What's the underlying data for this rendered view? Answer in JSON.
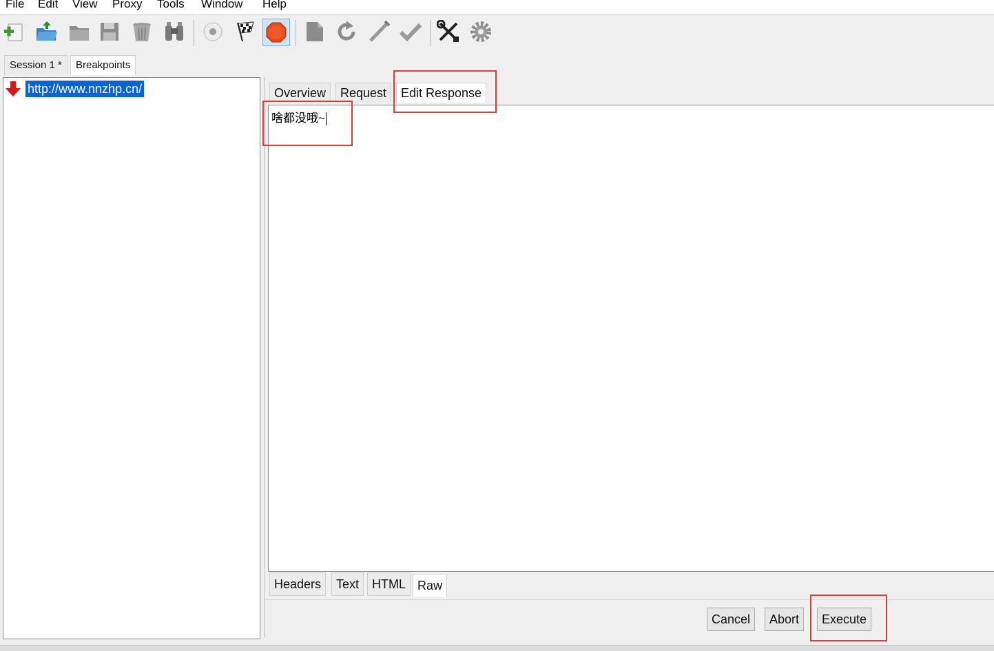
{
  "menu": [
    {
      "label": "File"
    },
    {
      "label": "Edit"
    },
    {
      "label": "View"
    },
    {
      "label": "Proxy"
    },
    {
      "label": "Tools"
    },
    {
      "label": "Window"
    },
    {
      "label": "Help"
    }
  ],
  "session_tabs": [
    {
      "label": "Session 1 *",
      "selected": false
    },
    {
      "label": "Breakpoints",
      "selected": true
    }
  ],
  "breakpoints": [
    {
      "url": "http://www.nnzhp.cn/"
    }
  ],
  "detail_tabs": [
    {
      "label": "Overview"
    },
    {
      "label": "Request"
    },
    {
      "label": "Edit Response",
      "selected": true
    }
  ],
  "editor": {
    "content": "啥都没哦~"
  },
  "format_tabs": [
    {
      "label": "Headers"
    },
    {
      "label": "Text"
    },
    {
      "label": "HTML"
    },
    {
      "label": "Raw",
      "selected": true
    }
  ],
  "buttons": {
    "cancel": "Cancel",
    "abort": "Abort",
    "execute": "Execute"
  },
  "colors": {
    "selection": "#0a64d6",
    "annotation": "#e03c3c",
    "stop_hexagon": "#e84c1c"
  }
}
